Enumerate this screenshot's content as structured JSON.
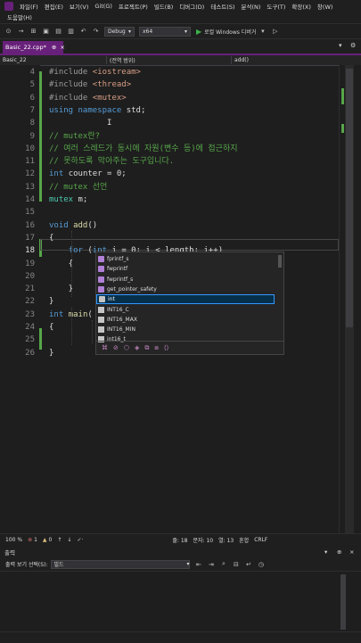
{
  "menu": {
    "row1": [
      "파일(F)",
      "편집(E)",
      "보기(V)",
      "Git(G)",
      "프로젝트(P)",
      "빌드(B)",
      "디버그(D)",
      "테스트(S)",
      "분석(N)",
      "도구(T)",
      "확장(X)",
      "창(W)"
    ],
    "row2": [
      "도움말(H)"
    ]
  },
  "toolbar": {
    "config": "Debug",
    "platform": "x64",
    "run_label": "로컬 Windows 디버거"
  },
  "tab": {
    "title": "Basic_22.cpp*",
    "pin": "⊕",
    "close": "×"
  },
  "navbar": {
    "project": "Basic_22",
    "scope": "(전역 범위)",
    "member": "add()"
  },
  "editor": {
    "line_numbers": [
      "4",
      "5",
      "6",
      "7",
      "8",
      "9",
      "10",
      "11",
      "12",
      "13",
      "14",
      "15",
      "16",
      "17",
      "18",
      "19",
      "20",
      "21",
      "22",
      "23",
      "24",
      "25",
      "26"
    ],
    "current_line": "18",
    "lines": [
      {
        "parts": [
          {
            "c": "pp",
            "t": "#include "
          },
          {
            "c": "str",
            "t": "<iostream>"
          }
        ]
      },
      {
        "parts": [
          {
            "c": "pp",
            "t": "#include "
          },
          {
            "c": "str",
            "t": "<thread>"
          }
        ]
      },
      {
        "parts": [
          {
            "c": "pp",
            "t": "#include "
          },
          {
            "c": "str",
            "t": "<mutex>"
          }
        ]
      },
      {
        "parts": [
          {
            "c": "kw",
            "t": "using namespace "
          },
          {
            "c": "id",
            "t": "std;"
          }
        ]
      },
      {
        "parts": [
          {
            "c": "id",
            "t": "            I"
          }
        ]
      },
      {
        "parts": [
          {
            "c": "cm",
            "t": "// mutex란?"
          }
        ]
      },
      {
        "parts": [
          {
            "c": "cm",
            "t": "// 여러 스레드가 동시에 자원(변수 등)에 접근하지"
          }
        ]
      },
      {
        "parts": [
          {
            "c": "cm",
            "t": "// 못하도록 막아주는 도구입니다."
          }
        ]
      },
      {
        "parts": [
          {
            "c": "kw",
            "t": "int "
          },
          {
            "c": "id",
            "t": "counter = 0;"
          }
        ]
      },
      {
        "parts": [
          {
            "c": "cm",
            "t": "// mutex 선언"
          }
        ]
      },
      {
        "parts": [
          {
            "c": "ty",
            "t": "mutex "
          },
          {
            "c": "id",
            "t": "m;"
          }
        ]
      },
      {
        "parts": [
          {
            "c": "id",
            "t": ""
          }
        ]
      },
      {
        "parts": [
          {
            "c": "kw",
            "t": "void "
          },
          {
            "c": "fn",
            "t": "add"
          },
          {
            "c": "id",
            "t": "()"
          }
        ]
      },
      {
        "parts": [
          {
            "c": "id",
            "t": "{"
          }
        ]
      },
      {
        "parts": [
          {
            "c": "id",
            "t": "    "
          },
          {
            "c": "kw",
            "t": "for "
          },
          {
            "c": "id",
            "t": "("
          },
          {
            "c": "kw",
            "t": "int"
          },
          {
            "c": "id",
            "t": " i = 0; i < "
          },
          {
            "c": "id",
            "t": "length"
          },
          {
            "c": "id",
            "t": "; i++)"
          }
        ]
      },
      {
        "parts": [
          {
            "c": "id",
            "t": "    {"
          }
        ]
      },
      {
        "parts": [
          {
            "c": "id",
            "t": ""
          }
        ]
      },
      {
        "parts": [
          {
            "c": "id",
            "t": "    }"
          }
        ]
      },
      {
        "parts": [
          {
            "c": "id",
            "t": "}"
          }
        ]
      },
      {
        "parts": [
          {
            "c": "kw",
            "t": "int "
          },
          {
            "c": "fn",
            "t": "main"
          },
          {
            "c": "id",
            "t": "("
          }
        ]
      },
      {
        "parts": [
          {
            "c": "id",
            "t": "{"
          }
        ]
      },
      {
        "parts": [
          {
            "c": "id",
            "t": ""
          }
        ]
      },
      {
        "parts": [
          {
            "c": "id",
            "t": "}"
          }
        ]
      }
    ]
  },
  "completion": {
    "items": [
      {
        "label": "fprintf_s",
        "kind": "func"
      },
      {
        "label": "fwprintf",
        "kind": "func"
      },
      {
        "label": "fwprintf_s",
        "kind": "func"
      },
      {
        "label": "get_pointer_safety",
        "kind": "func"
      },
      {
        "label": "int",
        "kind": "kwd",
        "selected": true
      },
      {
        "label": "INT16_C",
        "kind": "mac"
      },
      {
        "label": "INT16_MAX",
        "kind": "mac"
      },
      {
        "label": "INT16_MIN",
        "kind": "mac"
      },
      {
        "label": "int16_t",
        "kind": "mac"
      }
    ],
    "filters": [
      "⌘",
      "⊘",
      "⬡",
      "◈",
      "⧉",
      "⧈",
      "⟨⟩"
    ]
  },
  "status": {
    "zoom": "100 %",
    "errors": "1",
    "warnings": "0",
    "line": "줄: 18",
    "char": "문자: 10",
    "col": "열: 13",
    "mode": "혼합",
    "eol": "CRLF"
  },
  "output": {
    "title": "출력",
    "show_label": "출력 보기 선택(S):",
    "source": "빌드"
  }
}
